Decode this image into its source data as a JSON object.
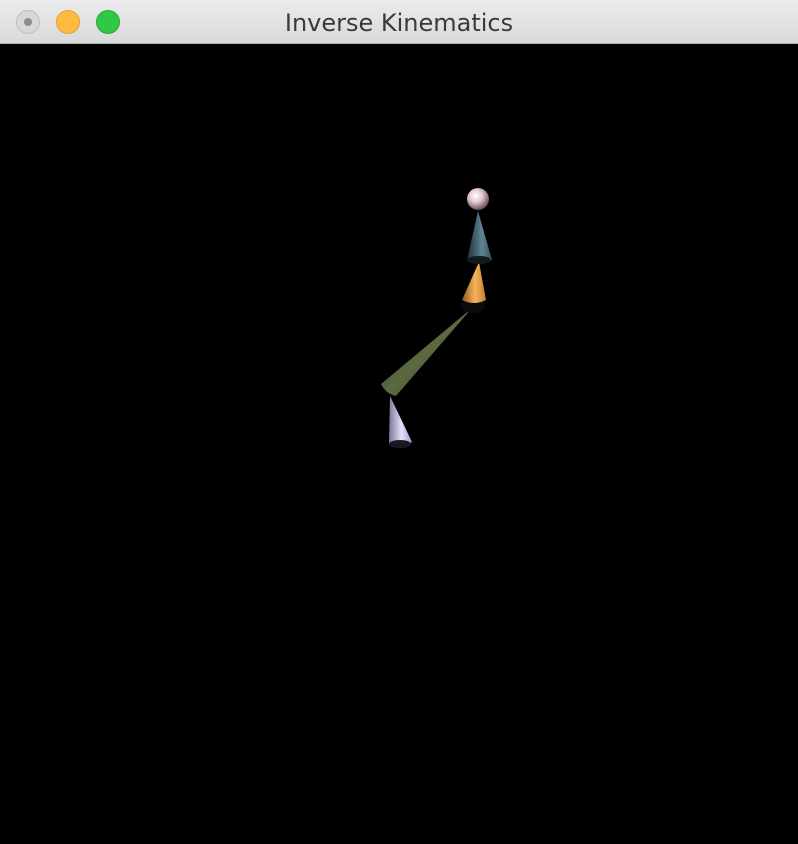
{
  "window": {
    "title": "Inverse Kinematics"
  },
  "colors": {
    "canvas_background": "#000000",
    "end_effector": "#e6c8d6",
    "segment_1": "#4a6a78",
    "segment_2": "#f0a848",
    "segment_3": "#4e5a38",
    "segment_4": "#c4c2e6"
  },
  "scene": {
    "joint_count": 4,
    "shape": "cone"
  }
}
